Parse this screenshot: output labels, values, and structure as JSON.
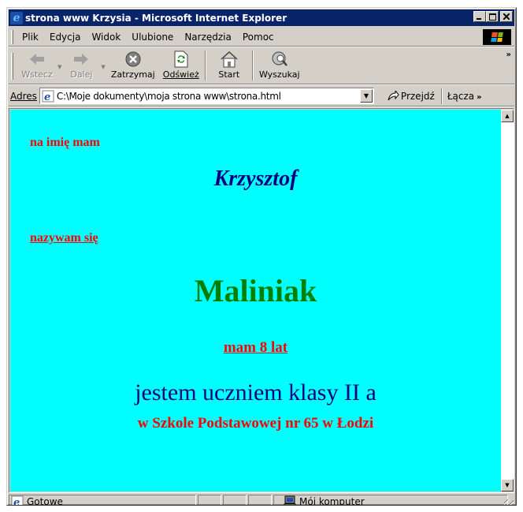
{
  "window": {
    "title": "strona www Krzysia - Microsoft Internet Explorer",
    "controls": {
      "minimize": "_",
      "maximize": "□",
      "close": "×"
    }
  },
  "menu": {
    "items": [
      "Plik",
      "Edycja",
      "Widok",
      "Ulubione",
      "Narzędzia",
      "Pomoc"
    ]
  },
  "toolbar": {
    "back_label": "Wstecz",
    "forward_label": "Dalej",
    "stop_label": "Zatrzymaj",
    "refresh_label": "Odśwież",
    "home_label": "Start",
    "search_label": "Wyszukaj",
    "more": "»"
  },
  "address": {
    "label": "Adres",
    "value": "C:\\Moje dokumenty\\moja strona www\\strona.html",
    "go_label": "Przejdź",
    "links_label": "Łącza",
    "links_more": "»"
  },
  "page": {
    "line1": "na imię mam",
    "first_name": "Krzysztof",
    "line2": "nazywam się",
    "surname": "Maliniak",
    "age": "mam 8 lat",
    "class_line": "jestem uczniem klasy II a",
    "school_line": "w Szkole Podstawowej nr 65 w Łodzi"
  },
  "status": {
    "text": "Gotowe",
    "zone": "Mój komputer"
  },
  "colors": {
    "titlebar": "#0a246a",
    "chrome": "#d4d0c8",
    "page_background": "#00ffff",
    "red_text": "#ff0000",
    "navy_text": "#000080",
    "green_text": "#008000"
  }
}
